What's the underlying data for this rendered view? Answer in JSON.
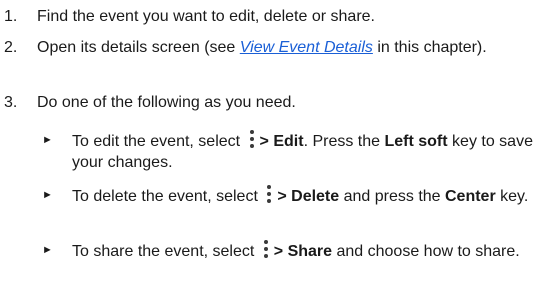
{
  "steps": [
    {
      "number": "1.",
      "text": "Find the event you want to edit, delete or share."
    },
    {
      "number": "2.",
      "text_before": "Open its details screen (see ",
      "link": "View Event Details",
      "text_after": " in this chapter)."
    },
    {
      "number": "3.",
      "text": "Do one of the following as you need."
    }
  ],
  "bullets": [
    {
      "bullet": "►",
      "pre": "To edit the event, select ",
      "icon": "more-vertical-icon",
      "action": "> Edit",
      "mid": ". Press the ",
      "key": "Left soft",
      "post": " key to save your changes."
    },
    {
      "bullet": "►",
      "pre": "To delete the event, select ",
      "icon": "more-vertical-icon",
      "action": "> Delete",
      "mid": " and press the ",
      "key": "Center",
      "post": " key."
    },
    {
      "bullet": "►",
      "pre": "To share the event, select ",
      "icon": "more-vertical-icon",
      "action": "> Share",
      "post": " and choose how to share."
    }
  ],
  "colors": {
    "text": "#1a1a1a",
    "link": "#1a5fd6"
  }
}
